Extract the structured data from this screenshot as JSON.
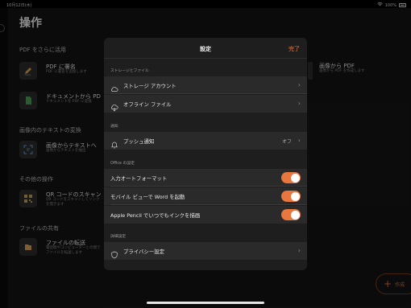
{
  "status": {
    "time": "10月12日(木)",
    "battery": "100%"
  },
  "app": {
    "title": "操作",
    "sections": [
      {
        "heading": "PDF をさらに活用"
      },
      {
        "heading": "画像内のテキストの変換"
      },
      {
        "heading": "その他の操作"
      },
      {
        "heading": "ファイルの共有"
      }
    ],
    "tiles": [
      {
        "title": "PDF に署名",
        "desc": "PDF に署名を追加します"
      },
      {
        "title": "ドキュメントから PD",
        "desc": "ドキュメントを PDF に変換"
      },
      {
        "title": "画像からテキストへ",
        "desc": "画像からテキストを抽出"
      },
      {
        "title": "QR コードのスキャン",
        "desc": "QR コードをスキャンしてリンクを開きます"
      },
      {
        "title": "ファイルの転送",
        "desc": "電話間やコンピューターとの間でファイルを転送します"
      }
    ],
    "right_tile": {
      "title": "画像から PDF",
      "desc": "画像から PDF を作成します"
    },
    "create_label": "作成"
  },
  "colors": {
    "accent": "#e8773f",
    "modal_bg": "#1e1e1e",
    "row_bg": "#2a2a2a"
  },
  "settings": {
    "title": "設定",
    "done_label": "完了",
    "groups": [
      {
        "heading": "ストレージとファイル",
        "rows": [
          {
            "label": "ストレージ アカウント",
            "icon": "cloud-icon"
          },
          {
            "label": "オフライン ファイル",
            "icon": "cloud-download-icon"
          }
        ]
      },
      {
        "heading": "通知",
        "rows": [
          {
            "label": "プッシュ通知",
            "icon": "bell-icon",
            "value": "オフ"
          }
        ]
      },
      {
        "heading": "Office の設定",
        "rows": [
          {
            "label": "入力オートフォーマット",
            "on": true
          },
          {
            "label": "モバイル ビューで Word を起動",
            "on": true
          },
          {
            "label": "Apple Pencil でいつでもインクを描画",
            "on": true
          }
        ]
      },
      {
        "heading": "詳細設定",
        "rows": [
          {
            "label": "プライバシー設定",
            "icon": "shield-icon"
          }
        ]
      }
    ]
  }
}
